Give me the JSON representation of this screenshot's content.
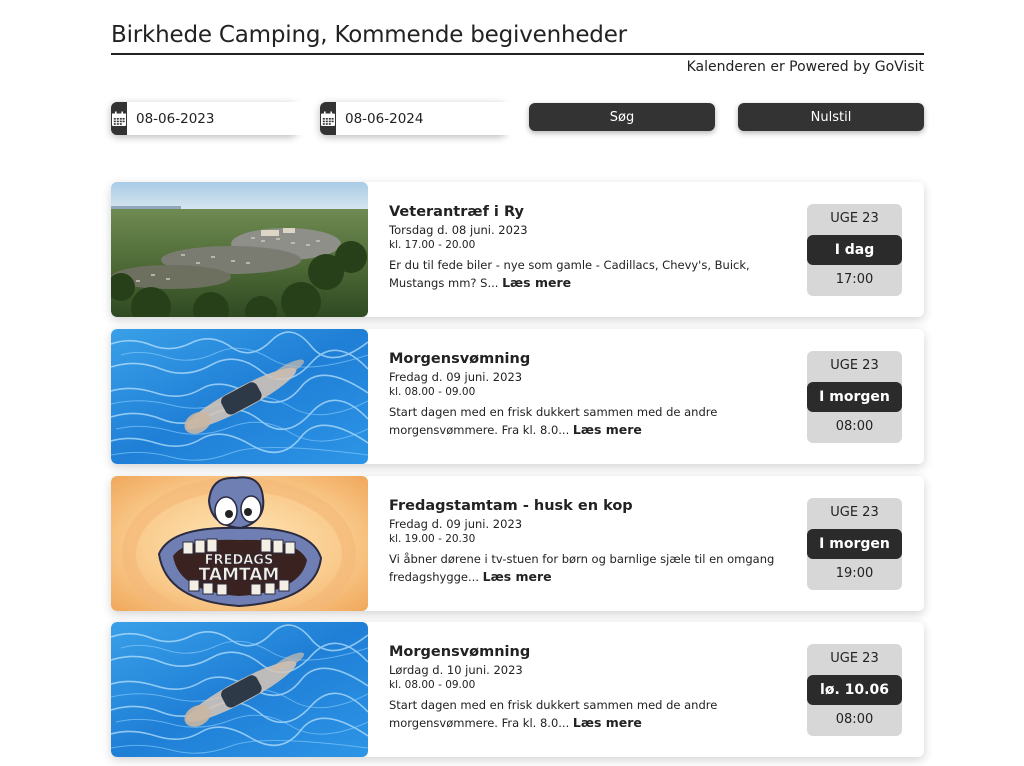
{
  "header": {
    "title": "Birkhede Camping, Kommende begivenheder",
    "powered_by": "Kalenderen er Powered by GoVisit"
  },
  "filters": {
    "start_date": "08-06-2023",
    "end_date": "08-06-2024",
    "search_label": "Søg",
    "reset_label": "Nulstil",
    "icon": "calendar-icon"
  },
  "colors": {
    "dark": "#333333",
    "badge_bg": "#d7d7d7",
    "badge_day_bg": "#2b2b2b"
  },
  "events": [
    {
      "title": "Veterantræf i Ry",
      "date": "Torsdag d. 08 juni. 2023",
      "time": "kl. 17.00 - 20.00",
      "desc": "Er du til fede biler - nye som gamle - Cadillacs, Chevy's, Buick, Mustangs mm? S...",
      "read_more": "Læs mere",
      "week": "UGE 23",
      "day": "I dag",
      "hour": "17:00",
      "image": "aerial-car-show-photo"
    },
    {
      "title": "Morgensvømning",
      "date": "Fredag d. 09 juni. 2023",
      "time": "kl. 08.00 - 09.00",
      "desc": "Start dagen med en frisk dukkert sammen med de andre morgensvømmere. Fra kl. 8.0...",
      "read_more": "Læs mere",
      "week": "UGE 23",
      "day": "I morgen",
      "hour": "08:00",
      "image": "swimmer-pool-photo"
    },
    {
      "title": "Fredagstamtam - husk en kop",
      "date": "Fredag d. 09 juni. 2023",
      "time": "kl. 19.00 - 20.30",
      "desc": "Vi åbner dørene i tv-stuen for børn og barnlige sjæle til en omgang fredagshygge...",
      "read_more": "Læs mere",
      "week": "UGE 23",
      "day": "I morgen",
      "hour": "19:00",
      "image": "fredagstamtam-cartoon",
      "image_text": [
        "FREDAGS",
        "TAMTAM"
      ]
    },
    {
      "title": "Morgensvømning",
      "date": "Lørdag d. 10 juni. 2023",
      "time": "kl. 08.00 - 09.00",
      "desc": "Start dagen med en frisk dukkert sammen med de andre morgensvømmere. Fra kl. 8.0...",
      "read_more": "Læs mere",
      "week": "UGE 23",
      "day": "lø. 10.06",
      "hour": "08:00",
      "image": "swimmer-pool-photo"
    }
  ]
}
